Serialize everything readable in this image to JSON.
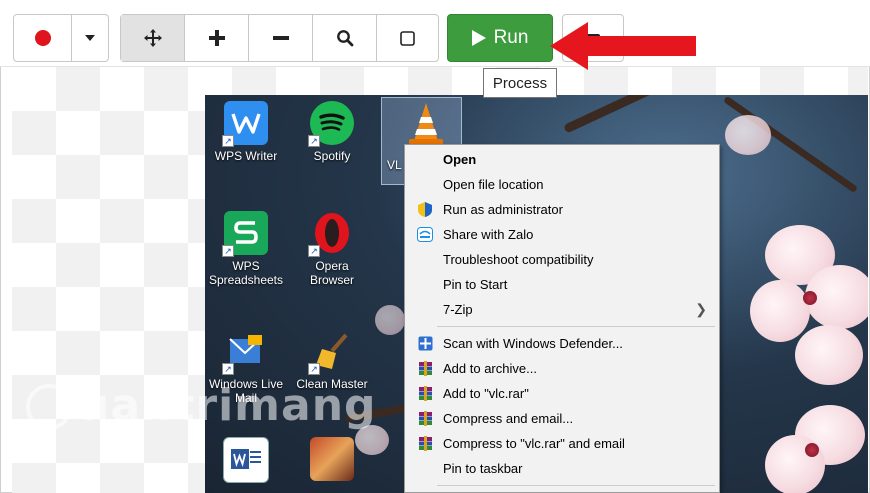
{
  "toolbar": {
    "run_label": "Run",
    "tooltip": "Process",
    "run_color": "#3d9c3d",
    "record_color": "#e0141d"
  },
  "desktop": {
    "icons": [
      {
        "label": "WPS Writer"
      },
      {
        "label": "Spotify"
      },
      {
        "label": "VL"
      },
      {
        "label": "WPS Spreadsheets"
      },
      {
        "label": "Opera Browser"
      },
      {
        "label": "Windows Live Mail"
      },
      {
        "label": "Clean Master"
      }
    ]
  },
  "context_menu": {
    "items": [
      {
        "label": "Open",
        "bold": true,
        "icon": "none"
      },
      {
        "label": "Open file location",
        "icon": "none"
      },
      {
        "label": "Run as administrator",
        "icon": "uac-shield-icon"
      },
      {
        "label": "Share with Zalo",
        "icon": "zalo-share-icon"
      },
      {
        "label": "Troubleshoot compatibility",
        "icon": "none"
      },
      {
        "label": "Pin to Start",
        "icon": "none"
      },
      {
        "label": "7-Zip",
        "icon": "none",
        "submenu": true
      },
      {
        "label": "Scan with Windows Defender...",
        "icon": "defender-icon"
      },
      {
        "label": "Add to archive...",
        "icon": "winrar-icon"
      },
      {
        "label": "Add to \"vlc.rar\"",
        "icon": "winrar-icon"
      },
      {
        "label": "Compress and email...",
        "icon": "winrar-icon"
      },
      {
        "label": "Compress to \"vlc.rar\" and email",
        "icon": "winrar-icon"
      },
      {
        "label": "Pin to taskbar",
        "icon": "none"
      }
    ]
  },
  "watermark": "uantrimang"
}
